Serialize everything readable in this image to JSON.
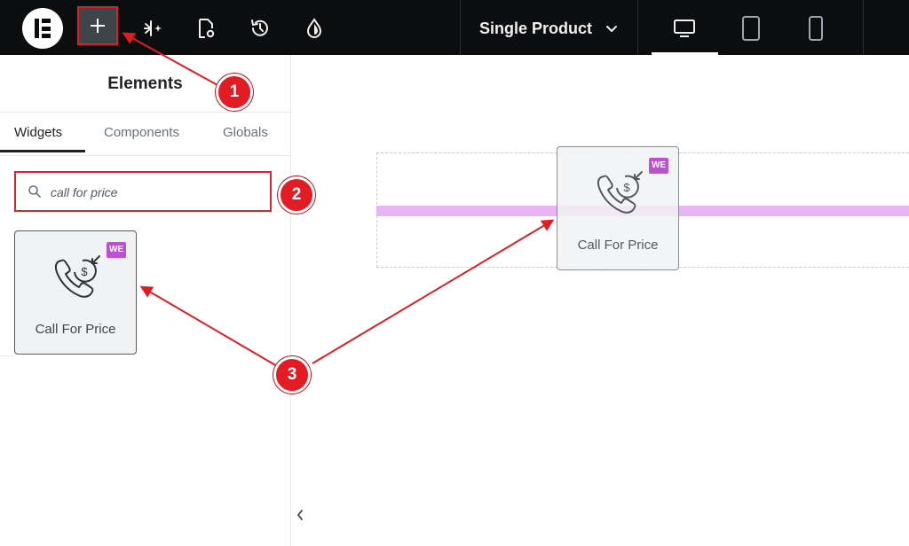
{
  "topbar": {
    "page_selector": "Single Product",
    "icons": [
      "elementor-logo-icon",
      "plus-icon",
      "sparkle-icon",
      "page-settings-icon",
      "history-icon",
      "theme-style-icon",
      "chevron-down-icon",
      "desktop-icon",
      "tablet-icon",
      "mobile-icon"
    ],
    "active_device": "desktop"
  },
  "panel": {
    "title": "Elements",
    "tabs": [
      {
        "label": "Widgets",
        "active": true
      },
      {
        "label": "Components",
        "active": false
      },
      {
        "label": "Globals",
        "active": false
      }
    ],
    "search": {
      "value": "call for price"
    },
    "widget": {
      "label": "Call For Price",
      "icon": "phone-dollar-icon"
    }
  },
  "canvas": {
    "drag_widget": {
      "label": "Call For Price"
    },
    "drop_indicator_color": "#e9b4f3"
  },
  "annotations": {
    "markers": [
      "1",
      "2",
      "3"
    ],
    "color": "#e31b23"
  },
  "colors": {
    "topbar": "#0c0d0e",
    "accent_badge": "#c04fd4",
    "highlight": "#e31b23"
  }
}
